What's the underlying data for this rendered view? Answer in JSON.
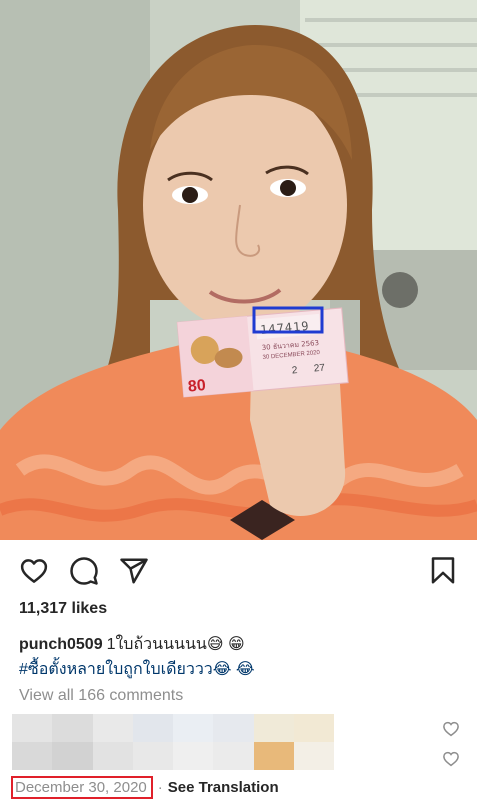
{
  "post": {
    "ticket_number": "147419",
    "ticket_price": "80",
    "ticket_date_thai": "30 ธันวาคม 2563",
    "ticket_date_en": "30 DECEMBER 2020",
    "ticket_draw_no": "27",
    "ticket_set": "2"
  },
  "actions": {
    "like_icon": "heart-icon",
    "comment_icon": "comment-icon",
    "share_icon": "paper-plane-icon",
    "save_icon": "bookmark-icon"
  },
  "likes": "11,317 likes",
  "caption": {
    "username": "punch0509",
    "line1_text": "1ใบถ้วนนนนน😅 😁",
    "line2_text": "#ซื้อตั้งหลายใบถูกใบเดียววว😂 😂"
  },
  "comments_link": "View all 166 comments",
  "meta": {
    "date": "December 30, 2020",
    "separator": "·",
    "see_translation": "See Translation"
  },
  "colors": {
    "highlight_red": "#e0202a",
    "highlight_blue": "#1f3bd1",
    "muted_text": "#8e8e8e",
    "hashtag": "#00376b"
  }
}
